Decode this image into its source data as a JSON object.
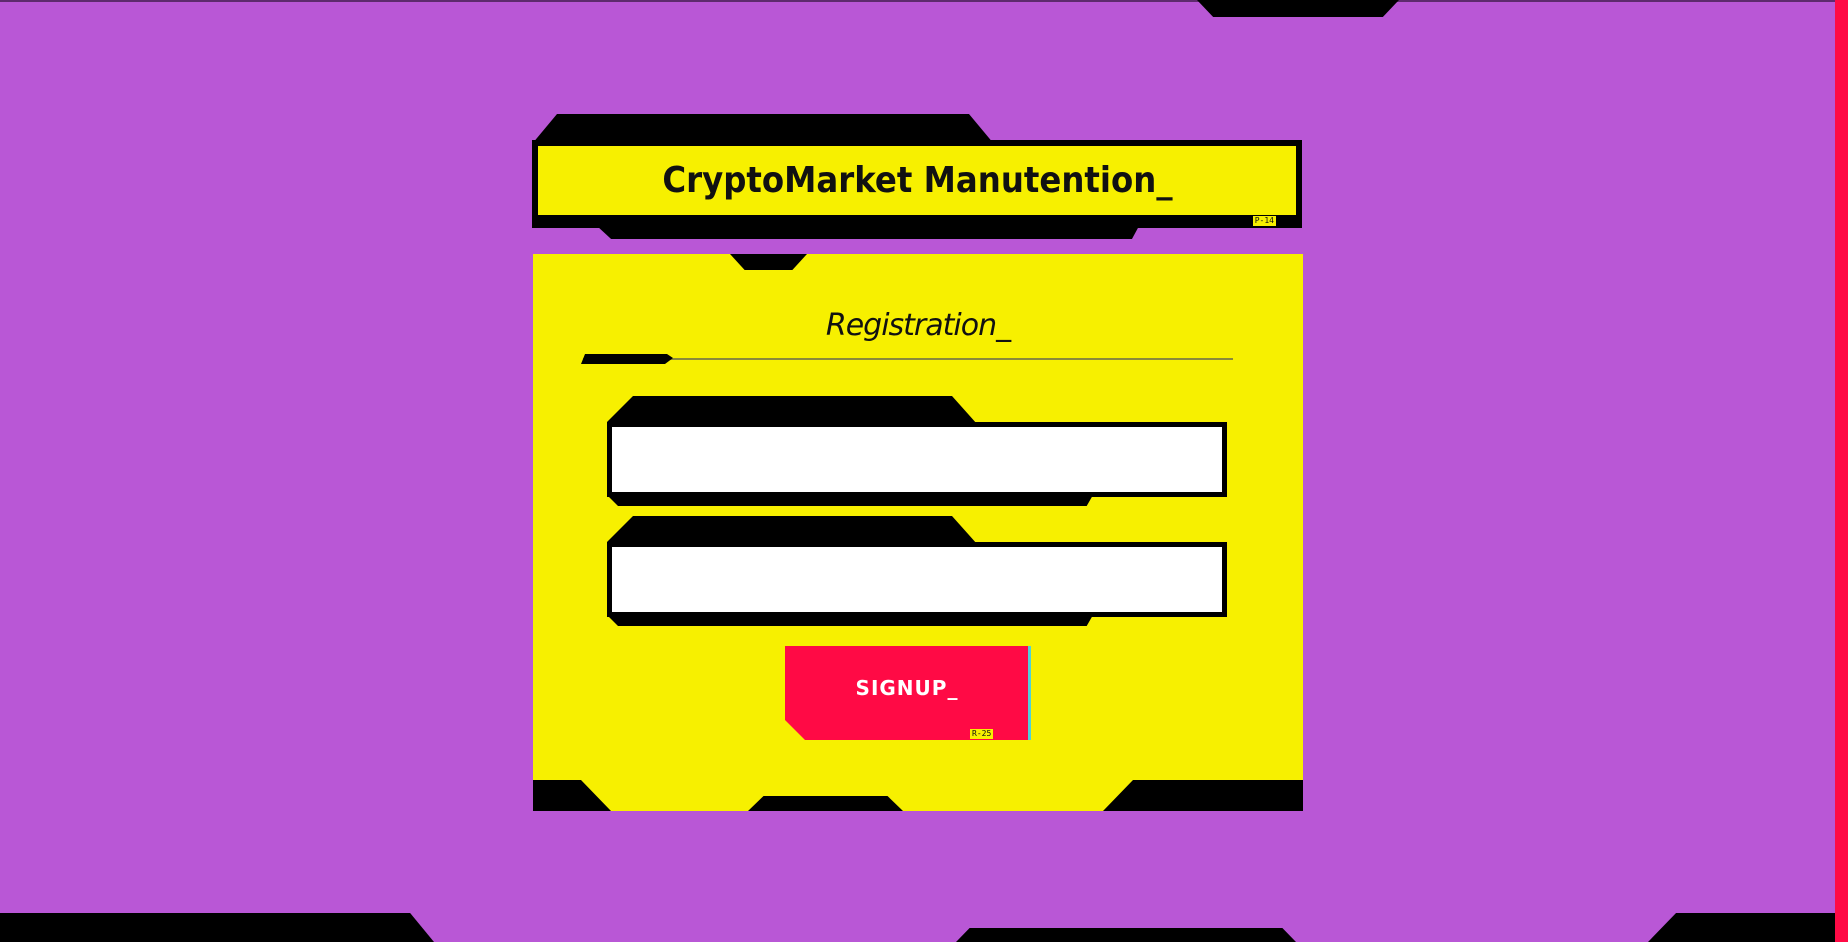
{
  "app": {
    "title": "CryptoMarket Manutention_",
    "header_tag": "P-14"
  },
  "registration": {
    "heading": "Registration_",
    "fields": [
      {
        "name": "field-1",
        "value": "",
        "placeholder": ""
      },
      {
        "name": "field-2",
        "value": "",
        "placeholder": ""
      }
    ],
    "signup_label": "SIGNUP_",
    "signup_tag": "R-25"
  },
  "colors": {
    "background": "#b957d6",
    "accent_yellow": "#f7f000",
    "accent_red": "#ff0a45",
    "frame_black": "#000000"
  }
}
